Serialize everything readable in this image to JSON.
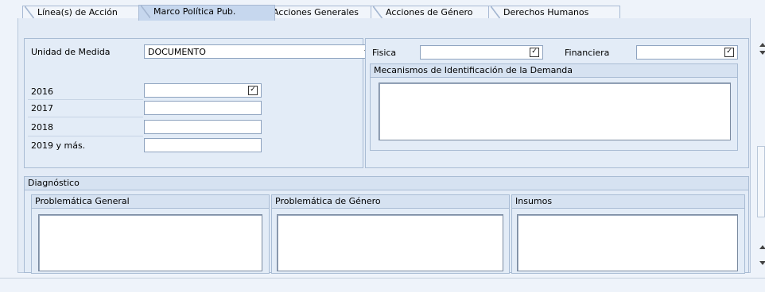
{
  "tabs": [
    {
      "label": "Línea(s) de Acción"
    },
    {
      "label": "Marco Política Pub."
    },
    {
      "label": "Acciones Generales"
    },
    {
      "label": "Acciones de Género"
    },
    {
      "label": "Derechos Humanos"
    }
  ],
  "active_tab": "Marco Política Pub.",
  "unidad": {
    "label": "Unidad de Medida",
    "value": "DOCUMENTO"
  },
  "years": [
    {
      "label": "2016",
      "value": ""
    },
    {
      "label": "2017",
      "value": ""
    },
    {
      "label": "2018",
      "value": ""
    },
    {
      "label": "2019 y más.",
      "value": ""
    }
  ],
  "fisica": {
    "label": "Fisica",
    "value": ""
  },
  "financiera": {
    "label": "Financiera",
    "value": ""
  },
  "mecanismos": {
    "title": "Mecanismos de Identificación de la Demanda",
    "value": ""
  },
  "diagnostico": {
    "title": "Diagnóstico",
    "sections": [
      {
        "title": "Problemática General",
        "value": ""
      },
      {
        "title": "Problemática de Género",
        "value": ""
      },
      {
        "title": "Insumos",
        "value": ""
      }
    ]
  },
  "icons": {
    "checkbox": "checkbox-icon",
    "dropdown": "chevron-down-icon",
    "scroll_up": "scroll-up-icon",
    "scroll_down": "scroll-down-icon"
  },
  "colors": {
    "active_tab": "#c6d7ee",
    "panel": "#e3ecf7",
    "panel_header": "#d6e2f1",
    "border": "#a9bcd4"
  }
}
